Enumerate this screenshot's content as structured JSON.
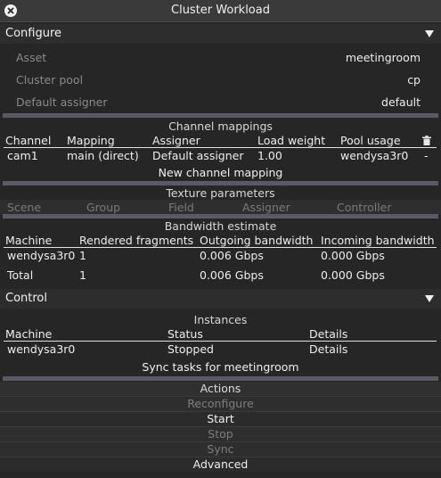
{
  "window": {
    "title": "Cluster Workload",
    "close_icon": "close-icon"
  },
  "configure": {
    "label": "Configure",
    "properties": [
      {
        "label": "Asset",
        "value": "meetingroom"
      },
      {
        "label": "Cluster pool",
        "value": "cp"
      },
      {
        "label": "Default assigner",
        "value": "default"
      }
    ]
  },
  "channel_mappings": {
    "title": "Channel mappings",
    "columns": [
      "Channel",
      "Mapping",
      "Assigner",
      "Load weight",
      "Pool usage"
    ],
    "delete_icon": "trash-icon",
    "rows": [
      {
        "channel": "cam1",
        "mapping": "main (direct)",
        "assigner": "Default assigner",
        "load_weight": "1.00",
        "pool_usage": "wendysa3r0",
        "extra": "-"
      }
    ],
    "new_label": "New channel mapping"
  },
  "texture_parameters": {
    "title": "Texture parameters",
    "columns": [
      "Scene",
      "Group",
      "Field",
      "Assigner",
      "Controller"
    ]
  },
  "bandwidth": {
    "title": "Bandwidth estimate",
    "columns": [
      "Machine",
      "Rendered fragments",
      "Outgoing bandwidth",
      "Incoming bandwidth"
    ],
    "rows": [
      {
        "machine": "wendysa3r0",
        "fragments": "1",
        "outgoing": "0.006 Gbps",
        "incoming": "0.000 Gbps"
      },
      {
        "machine": "Total",
        "fragments": "1",
        "outgoing": "0.006 Gbps",
        "incoming": "0.000 Gbps"
      }
    ]
  },
  "control": {
    "label": "Control",
    "instances": {
      "title": "Instances",
      "columns": [
        "Machine",
        "Status",
        "Details"
      ],
      "rows": [
        {
          "machine": "wendysa3r0",
          "status": "Stopped",
          "details": "Details"
        }
      ]
    },
    "sync_tasks_label": "Sync tasks for meetingroom",
    "actions": {
      "title": "Actions",
      "reconfigure": "Reconfigure",
      "start": "Start",
      "stop": "Stop",
      "sync": "Sync",
      "advanced": "Advanced"
    }
  }
}
